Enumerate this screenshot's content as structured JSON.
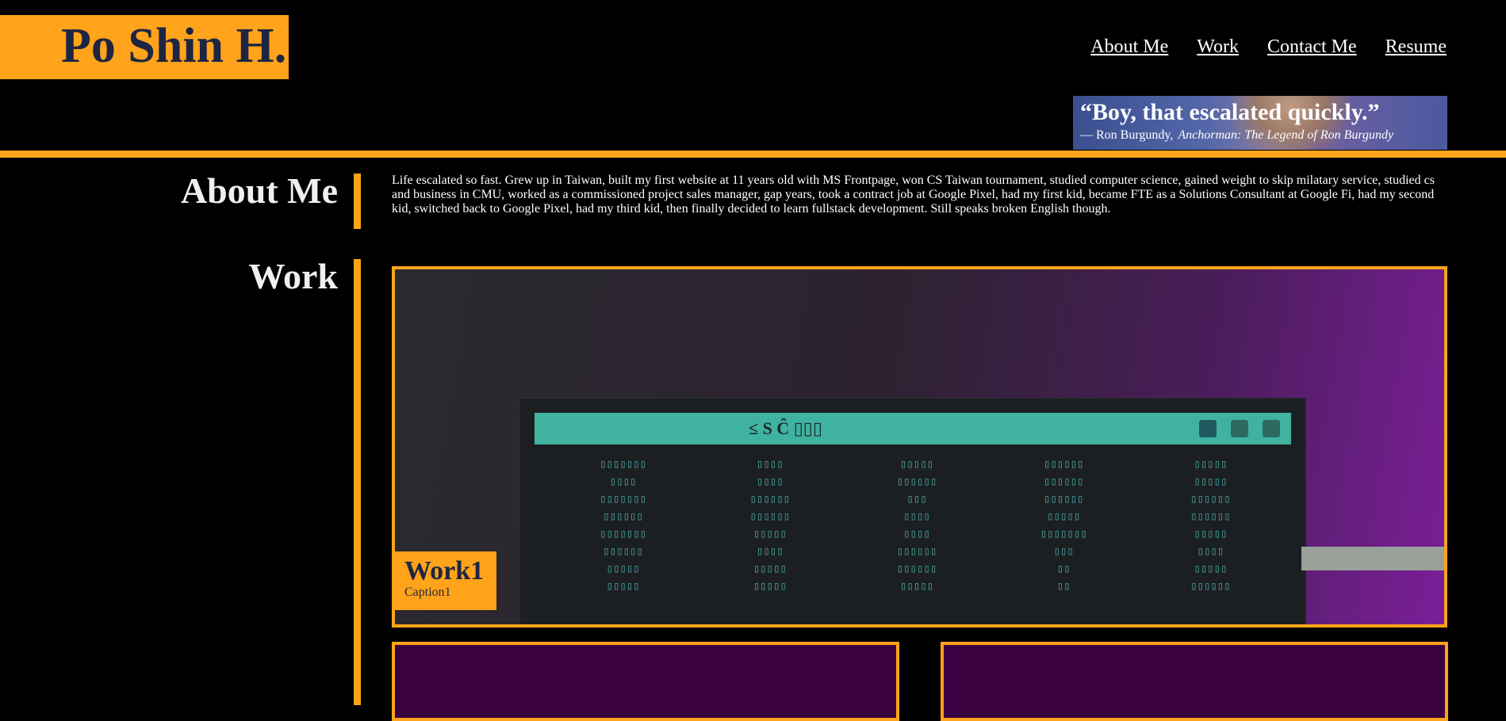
{
  "header": {
    "logo_text": "Po Shin H.",
    "nav": [
      "About Me",
      "Work",
      "Contact Me",
      "Resume"
    ],
    "quote": {
      "text": "“Boy, that escalated quickly.”",
      "attribution": "— Ron Burgundy,",
      "source": "Anchorman: The Legend of Ron Burgundy"
    }
  },
  "about": {
    "title": "About Me",
    "body": "Life escalated so fast. Grew up in Taiwan, built my first website at 11 years old with MS Frontpage, won CS Taiwan tournament, studied computer science, gained weight to skip milatary service, studied cs and business in CMU, worked as a commissioned project sales manager, gap years, took a contract job at Google Pixel, had my first kid, became FTE as a Solutions Consultant at Google Fi, had my second kid, switched back to Google Pixel, had my third kid, then finally decided to learn fullstack development. Still speaks broken English though."
  },
  "work": {
    "title": "Work",
    "featured": {
      "title": "Work1",
      "caption": "Caption1"
    }
  },
  "colors": {
    "accent": "#ffa31a",
    "logo_text": "#1e2542",
    "background": "#000000"
  }
}
